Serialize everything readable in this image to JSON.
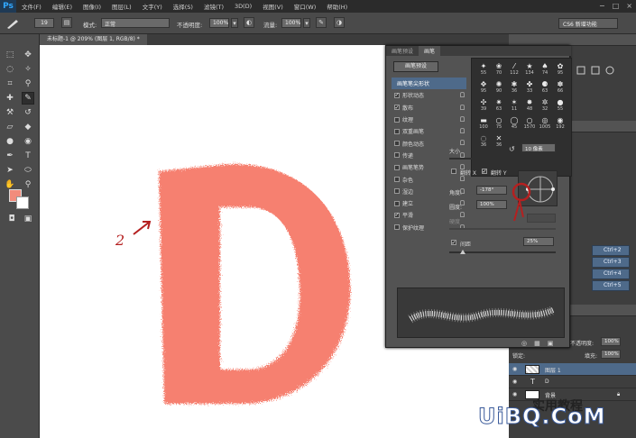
{
  "menubar": {
    "logo": "Ps",
    "items": [
      "文件(F)",
      "编辑(E)",
      "图像(I)",
      "图层(L)",
      "文字(Y)",
      "选择(S)",
      "滤镜(T)",
      "3D(D)",
      "视图(V)",
      "窗口(W)",
      "帮助(H)"
    ],
    "controls": [
      "−",
      "□",
      "×"
    ]
  },
  "options": {
    "brush_size": "19",
    "mode_label": "模式:",
    "mode_value": "正常",
    "opacity_label": "不透明度:",
    "opacity_value": "100%",
    "flow_label": "流量:",
    "flow_value": "100%",
    "workspace": "CS6 新增功能"
  },
  "document": {
    "tab_title": "未标题-1 @ 209% (图层 1, RGB/8) *",
    "annotation": "2"
  },
  "brush_panel": {
    "tabs": [
      "画笔预设",
      "画笔"
    ],
    "presets_button": "画笔预设",
    "list": [
      {
        "label": "画笔笔尖形状",
        "checked": false,
        "head": true
      },
      {
        "label": "形状动态",
        "checked": true
      },
      {
        "label": "散布",
        "checked": true
      },
      {
        "label": "纹理",
        "checked": false
      },
      {
        "label": "双重画笔",
        "checked": false
      },
      {
        "label": "颜色动态",
        "checked": false
      },
      {
        "label": "传递",
        "checked": false
      },
      {
        "label": "画笔笔势",
        "checked": false
      },
      {
        "label": "杂色",
        "checked": false
      },
      {
        "label": "湿边",
        "checked": false
      },
      {
        "label": "建立",
        "checked": false
      },
      {
        "label": "平滑",
        "checked": true
      },
      {
        "label": "保护纹理",
        "checked": false
      }
    ],
    "tip_numbers": [
      "55",
      "70",
      "112",
      "134",
      "74",
      "95",
      "95",
      "90",
      "36",
      "33",
      "63",
      "66",
      "39",
      "63",
      "11",
      "48",
      "32",
      "55",
      "100",
      "75",
      "45",
      "1570",
      "1005",
      "192",
      "36",
      "36"
    ],
    "size_label": "大小",
    "size_value": "10 像素",
    "flip_x": "翻转 X",
    "flip_y": "翻转 Y",
    "angle_label": "角度:",
    "angle_value": "-178°",
    "roundness_label": "圆度:",
    "roundness_value": "100%",
    "hardness_label": "硬度",
    "spacing_label": "间距",
    "spacing_value": "25%"
  },
  "layers": {
    "shortcuts": [
      "Ctrl+2",
      "Ctrl+3",
      "Ctrl+4",
      "Ctrl+5"
    ],
    "opacity_label": "不透明度:",
    "opacity_value": "100%",
    "lock_label": "锁定:",
    "fill_label": "填充:",
    "fill_value": "100%",
    "rows": [
      {
        "name": "图层 1",
        "type": "pixel"
      },
      {
        "name": "D",
        "type": "text"
      },
      {
        "name": "背景",
        "type": "background"
      }
    ]
  },
  "watermark": {
    "site_cn": "实用教程",
    "site": "UiBQ.CoM"
  },
  "colors": {
    "foreground": "#f28c7c",
    "letter_d": "#f6806f",
    "annotation_red": "#b52020"
  }
}
